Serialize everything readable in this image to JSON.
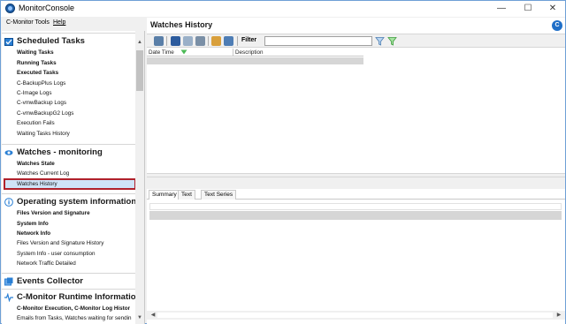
{
  "window": {
    "title": "MonitorConsole",
    "min_glyph": "—",
    "max_glyph": "☐",
    "close_glyph": "✕"
  },
  "menu": {
    "items": [
      "C-Monitor Tools",
      "Help"
    ]
  },
  "nav": {
    "sections": [
      {
        "title": "Scheduled Tasks",
        "icon": "calendar-check-icon",
        "items": [
          {
            "label": "Waiting Tasks",
            "bold": true
          },
          {
            "label": "Running Tasks",
            "bold": true
          },
          {
            "label": "Executed Tasks",
            "bold": true
          },
          {
            "label": "C-BackupPlus Logs",
            "bold": false
          },
          {
            "label": "C-Image Logs",
            "bold": false
          },
          {
            "label": "C-vmwBackup Logs",
            "bold": false
          },
          {
            "label": "C-vmwBackupG2 Logs",
            "bold": false
          },
          {
            "label": "Execution Fails",
            "bold": false
          },
          {
            "label": "Waiting Tasks History",
            "bold": false
          }
        ]
      },
      {
        "title": "Watches - monitoring",
        "icon": "eye-icon",
        "items": [
          {
            "label": "Watches State",
            "bold": true
          },
          {
            "label": "Watches Current Log",
            "bold": false
          },
          {
            "label": "Watches History",
            "bold": false,
            "selected": true
          }
        ]
      },
      {
        "title": "Operating system information's",
        "icon": "info-icon",
        "items": [
          {
            "label": "Files Version and Signature",
            "bold": true
          },
          {
            "label": "System Info",
            "bold": true
          },
          {
            "label": "Network Info",
            "bold": true
          },
          {
            "label": "Files Version and Signature History",
            "bold": false
          },
          {
            "label": "System Info - user consumption",
            "bold": false
          },
          {
            "label": "Network Traffic Detailed",
            "bold": false
          }
        ]
      },
      {
        "title": "Events Collector",
        "icon": "events-collector-icon",
        "items": []
      },
      {
        "title": "C-Monitor Runtime Information",
        "icon": "pulse-icon",
        "items": [
          {
            "label": "C-Monitor Execution, C-Monitor Log Histor",
            "bold": true
          },
          {
            "label": "Emails from Tasks, Watches waiting for sendin",
            "bold": false
          }
        ]
      }
    ]
  },
  "main": {
    "title": "Watches History",
    "help_badge": "C",
    "toolbar": {
      "filter_label": "Filter",
      "filter_value": ""
    },
    "grid": {
      "columns": [
        "Date Time",
        "Description"
      ]
    },
    "detail_tabs": [
      "Summary",
      "Text",
      "Text Series"
    ],
    "active_tab": "Summary"
  },
  "colors": {
    "selection_border": "#b0212b",
    "selection_fill": "#cfe3f7",
    "accent": "#1f6fc8"
  }
}
